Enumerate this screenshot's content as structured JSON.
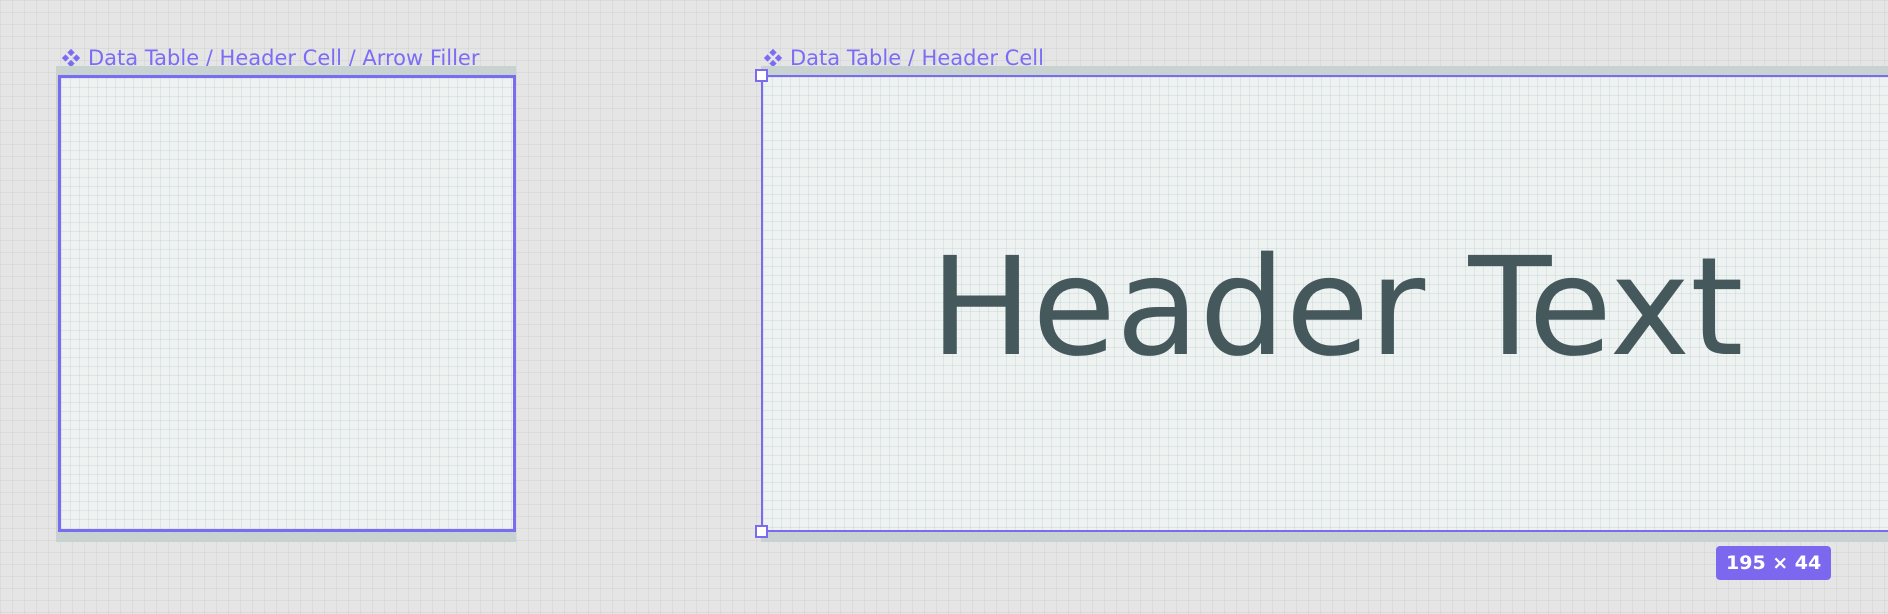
{
  "canvas": {
    "background_color": "#e5e5e5",
    "accent_color": "#7b6cf6"
  },
  "frames": [
    {
      "label": "Data Table / Header Cell / Arrow Filler",
      "icon": "component-icon",
      "selected": false
    },
    {
      "label": "Data Table / Header Cell",
      "icon": "component-icon",
      "selected": true,
      "content_text": "Header Text",
      "content_color": "#45595d"
    }
  ],
  "selection": {
    "size_label": "195 × 44"
  }
}
